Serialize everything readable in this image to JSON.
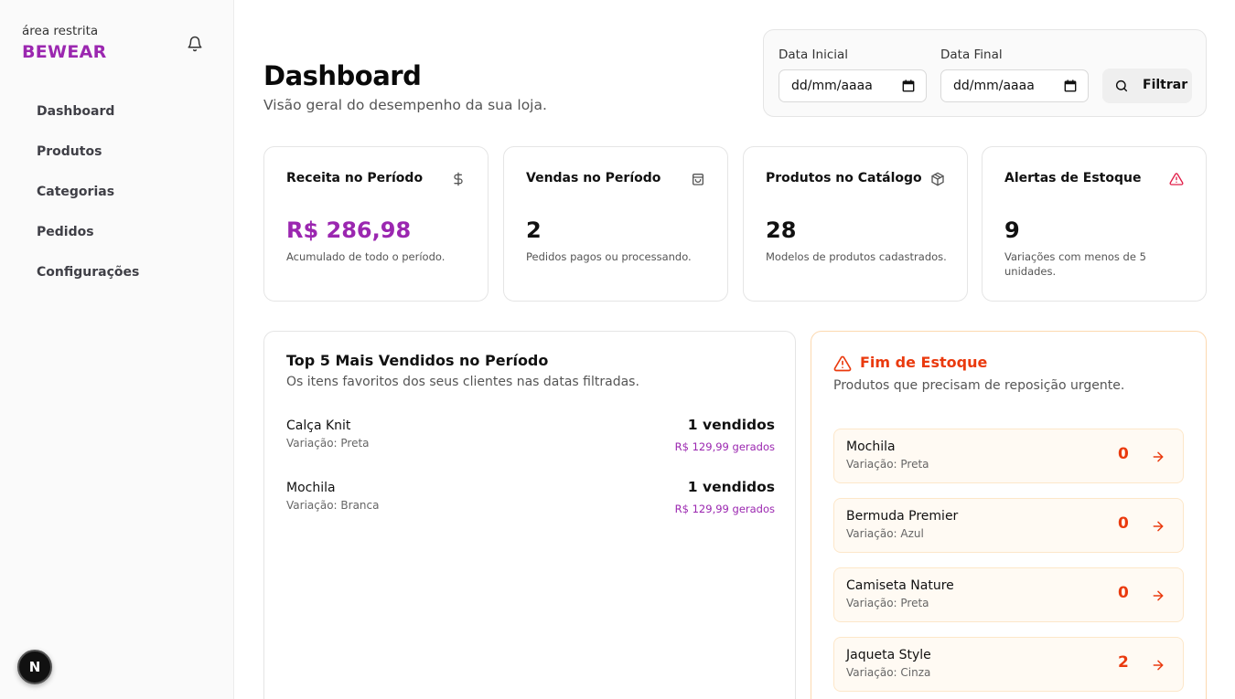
{
  "sidebar": {
    "area_label": "área restrita",
    "brand": "BEWEAR",
    "nav": [
      {
        "label": "Dashboard"
      },
      {
        "label": "Produtos"
      },
      {
        "label": "Categorias"
      },
      {
        "label": "Pedidos"
      },
      {
        "label": "Configurações"
      }
    ],
    "badge": "N"
  },
  "header": {
    "title": "Dashboard",
    "subtitle": "Visão geral do desempenho da sua loja."
  },
  "filter": {
    "start_label": "Data Inicial",
    "start_value": "dd/mm/aaaa",
    "end_label": "Data Final",
    "end_value": "dd/mm/aaaa",
    "button_label": "Filtrar"
  },
  "stats": [
    {
      "title": "Receita no Período",
      "value": "R$ 286,98",
      "desc": "Acumulado de todo o período.",
      "icon": "dollar-icon"
    },
    {
      "title": "Vendas no Período",
      "value": "2",
      "desc": "Pedidos pagos ou processando.",
      "icon": "shopping-bag-icon"
    },
    {
      "title": "Produtos no Catálogo",
      "value": "28",
      "desc": "Modelos de produtos cadastrados.",
      "icon": "package-icon"
    },
    {
      "title": "Alertas de Estoque",
      "value": "9",
      "desc": "Variações com menos de 5 unidades.",
      "icon": "alert-triangle-icon"
    }
  ],
  "top_sellers": {
    "title": "Top 5 Mais Vendidos no Período",
    "subtitle": "Os itens favoritos dos seus clientes nas datas filtradas.",
    "items": [
      {
        "name": "Calça Knit",
        "variation": "Variação: Preta",
        "sold": "1 vendidos",
        "revenue": "R$ 129,99 gerados"
      },
      {
        "name": "Mochila",
        "variation": "Variação: Branca",
        "sold": "1 vendidos",
        "revenue": "R$ 129,99 gerados"
      }
    ]
  },
  "low_stock": {
    "title": "Fim de Estoque",
    "subtitle": "Produtos que precisam de reposição urgente.",
    "items": [
      {
        "name": "Mochila",
        "variation": "Variação: Preta",
        "qty": "0"
      },
      {
        "name": "Bermuda Premier",
        "variation": "Variação: Azul",
        "qty": "0"
      },
      {
        "name": "Camiseta Nature",
        "variation": "Variação: Preta",
        "qty": "0"
      },
      {
        "name": "Jaqueta Style",
        "variation": "Variação: Cinza",
        "qty": "2"
      }
    ]
  },
  "colors": {
    "brand": "#9b27b0",
    "alert": "#ea3a0e"
  }
}
